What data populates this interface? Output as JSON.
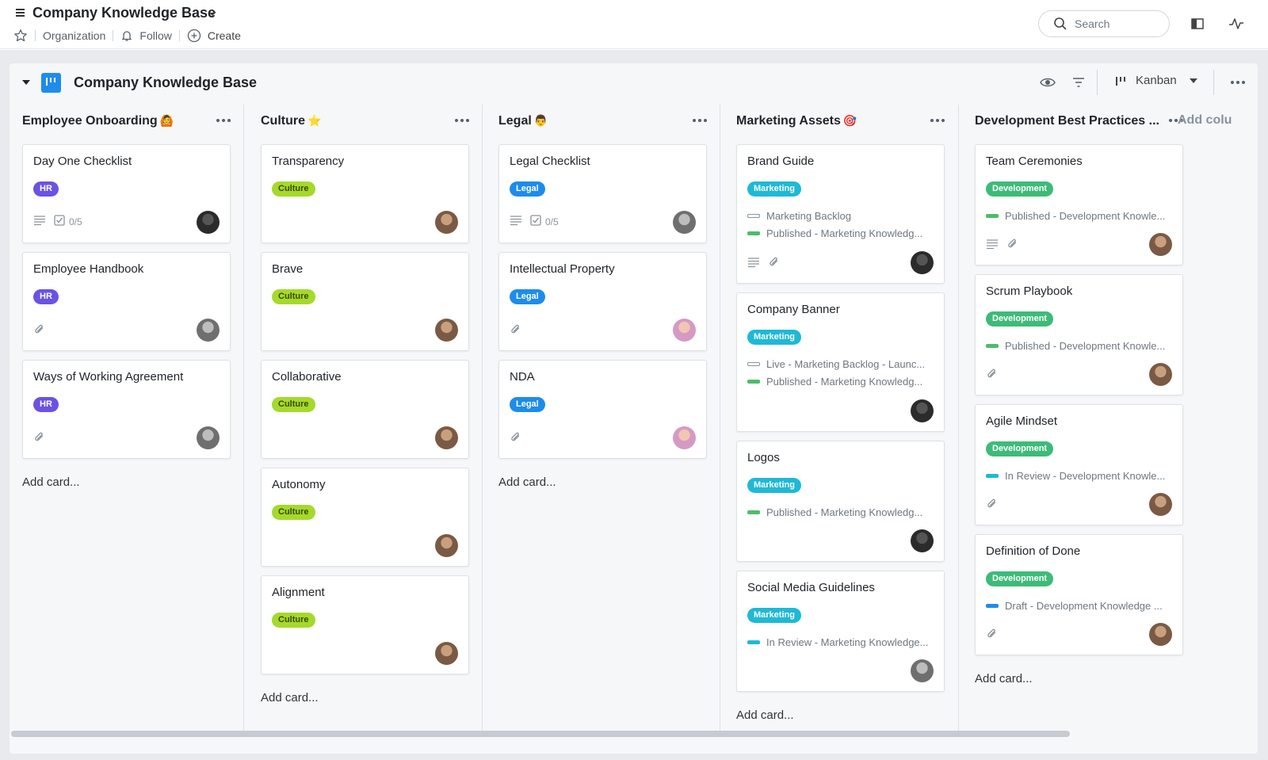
{
  "header": {
    "title": "Company Knowledge Base",
    "organization_label": "Organization",
    "follow_label": "Follow",
    "create_label": "Create",
    "search_placeholder": "Search"
  },
  "board": {
    "title": "Company Knowledge Base",
    "view_label": "Kanban",
    "add_column_label": "Add colu"
  },
  "colors": {
    "hr": "#6b52e3",
    "culture": "#a5d92b",
    "legal": "#1d8ceb",
    "marketing": "#1eb9d6",
    "development": "#3dbb78",
    "status_published": "#4cbd6b",
    "status_in_review": "#1eb9d6",
    "status_draft": "#1d8ceb"
  },
  "columns": [
    {
      "title": "Employee Onboarding",
      "emoji": "🙆",
      "add_card_label": "Add card...",
      "cards": [
        {
          "title": "Day One Checklist",
          "tag": "HR",
          "checklist": "0/5"
        },
        {
          "title": "Employee Handbook",
          "tag": "HR"
        },
        {
          "title": "Ways of Working Agreement",
          "tag": "HR"
        }
      ]
    },
    {
      "title": "Culture",
      "emoji": "⭐",
      "add_card_label": "Add card...",
      "cards": [
        {
          "title": "Transparency",
          "tag": "Culture"
        },
        {
          "title": "Brave",
          "tag": "Culture"
        },
        {
          "title": "Collaborative",
          "tag": "Culture"
        },
        {
          "title": "Autonomy",
          "tag": "Culture"
        },
        {
          "title": "Alignment",
          "tag": "Culture"
        }
      ]
    },
    {
      "title": "Legal",
      "emoji": "👨",
      "add_card_label": "Add card...",
      "cards": [
        {
          "title": "Legal Checklist",
          "tag": "Legal",
          "checklist": "0/5"
        },
        {
          "title": "Intellectual Property",
          "tag": "Legal"
        },
        {
          "title": "NDA",
          "tag": "Legal"
        }
      ]
    },
    {
      "title": "Marketing Assets",
      "emoji": "🎯",
      "add_card_label": "Add card...",
      "cards": [
        {
          "title": "Brand Guide",
          "tag": "Marketing",
          "relations": [
            "Marketing Backlog",
            "Published - Marketing Knowledg..."
          ]
        },
        {
          "title": "Company Banner",
          "tag": "Marketing",
          "relations": [
            "Live - Marketing Backlog - Launc...",
            "Published - Marketing Knowledg..."
          ]
        },
        {
          "title": "Logos",
          "tag": "Marketing",
          "relations": [
            "Published - Marketing Knowledg..."
          ]
        },
        {
          "title": "Social Media Guidelines",
          "tag": "Marketing",
          "relations": [
            "In Review - Marketing Knowledge..."
          ]
        }
      ]
    },
    {
      "title": "Development Best Practices ...",
      "emoji": "",
      "add_card_label": "Add card...",
      "cards": [
        {
          "title": "Team Ceremonies",
          "tag": "Development",
          "relations": [
            "Published - Development Knowle..."
          ]
        },
        {
          "title": "Scrum Playbook",
          "tag": "Development",
          "relations": [
            "Published - Development Knowle..."
          ]
        },
        {
          "title": "Agile Mindset",
          "tag": "Development",
          "relations": [
            "In Review - Development Knowle..."
          ]
        },
        {
          "title": "Definition of Done",
          "tag": "Development",
          "relations": [
            "Draft - Development Knowledge ..."
          ]
        }
      ]
    }
  ]
}
